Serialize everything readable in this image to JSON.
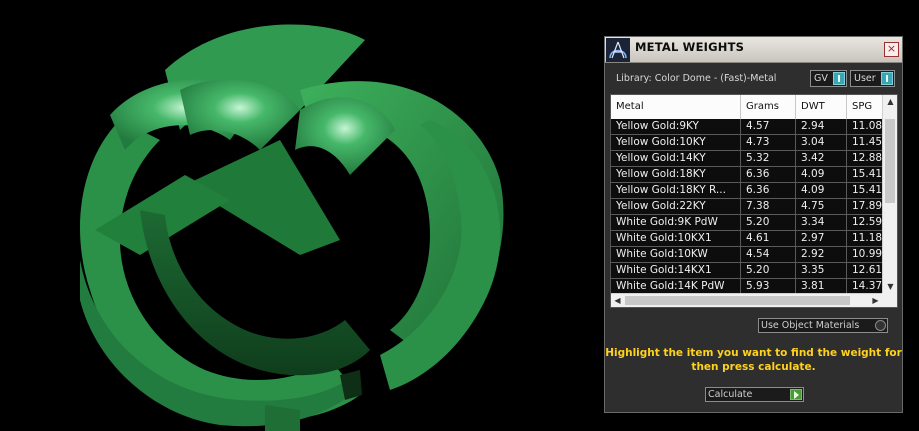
{
  "panel": {
    "title": "METAL WEIGHTS",
    "close_glyph": "×",
    "library_label": "Library: Color Dome - (Fast)-Metal",
    "toggles": {
      "gv": "GV",
      "user": "User"
    },
    "use_object_materials": "Use Object Materials",
    "hint": "Highlight the item you want to find the weight for then press calculate.",
    "calculate_label": "Calculate",
    "accent_color": "#ffd21e"
  },
  "table": {
    "columns": [
      "Metal",
      "Grams",
      "DWT",
      "SPG"
    ],
    "rows": [
      [
        "Yellow Gold:9KY",
        "4.57",
        "2.94",
        "11.08"
      ],
      [
        "Yellow Gold:10KY",
        "4.73",
        "3.04",
        "11.45"
      ],
      [
        "Yellow Gold:14KY",
        "5.32",
        "3.42",
        "12.88"
      ],
      [
        "Yellow Gold:18KY",
        "6.36",
        "4.09",
        "15.41"
      ],
      [
        "Yellow Gold:18KY R...",
        "6.36",
        "4.09",
        "15.41"
      ],
      [
        "Yellow Gold:22KY",
        "7.38",
        "4.75",
        "17.89"
      ],
      [
        "White Gold:9K PdW",
        "5.20",
        "3.34",
        "12.59"
      ],
      [
        "White Gold:10KX1",
        "4.61",
        "2.97",
        "11.18"
      ],
      [
        "White Gold:10KW",
        "4.54",
        "2.92",
        "10.99"
      ],
      [
        "White Gold:14KX1",
        "5.20",
        "3.35",
        "12.61"
      ],
      [
        "White Gold:14K PdW",
        "5.93",
        "3.81",
        "14.37"
      ]
    ]
  },
  "icons": {
    "app_logo": "dome-logo-icon",
    "close": "close-icon",
    "calculate": "play-icon"
  },
  "viewport": {
    "object": "green ring model",
    "ring_color": "#2a8a45"
  }
}
